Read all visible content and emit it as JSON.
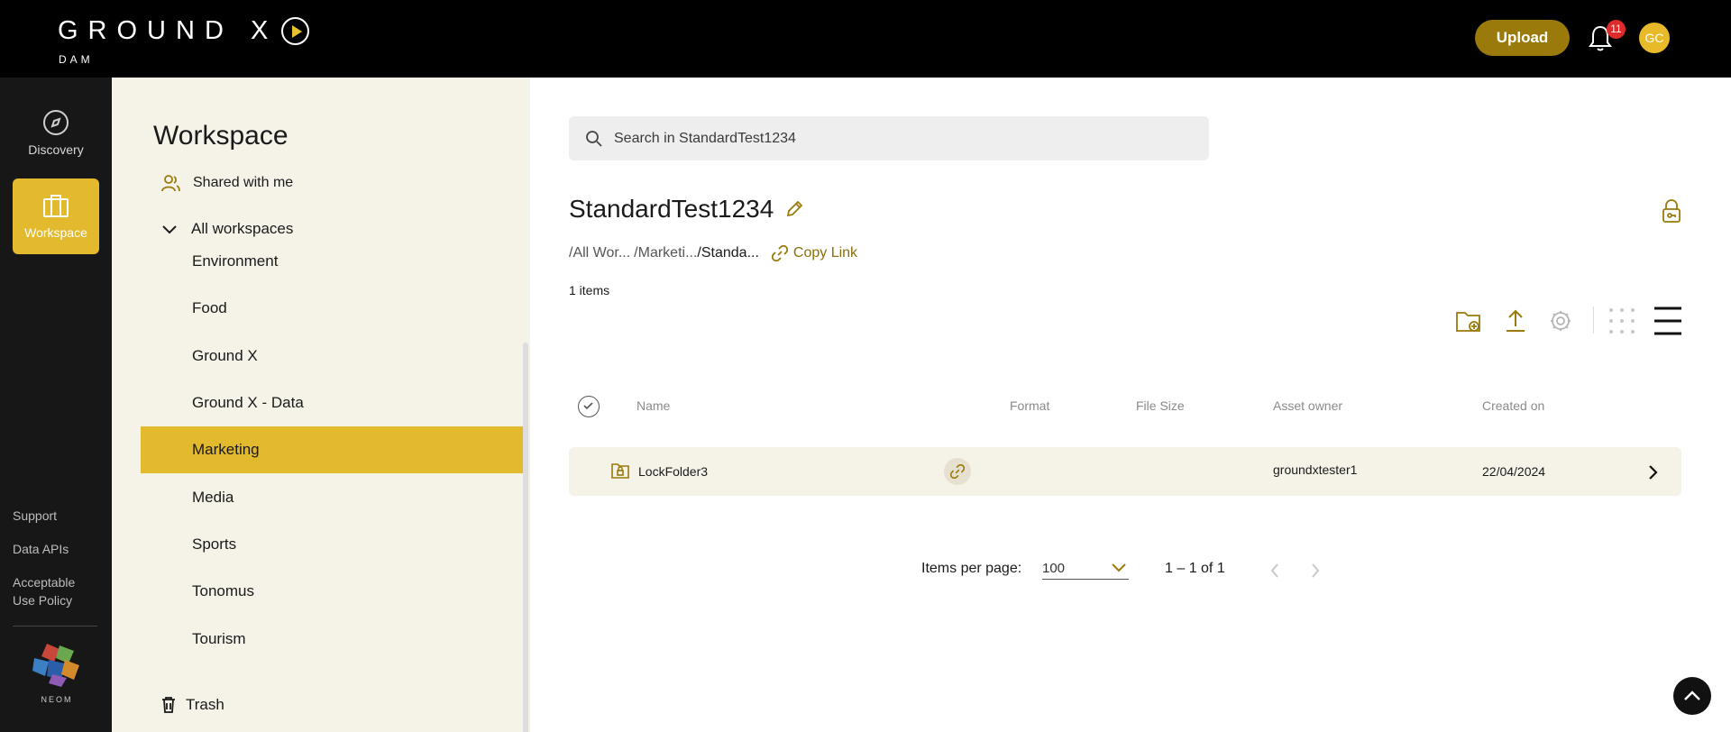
{
  "header": {
    "logo_main": "GROUND X",
    "logo_sub": "DAM",
    "upload_label": "Upload",
    "notification_count": "11",
    "avatar_initials": "GC"
  },
  "rail": {
    "discovery_label": "Discovery",
    "workspace_label": "Workspace",
    "links": [
      "Support",
      "Data APIs",
      "Acceptable Use Policy"
    ],
    "brand": "NEOM"
  },
  "sidebar": {
    "title": "Workspace",
    "shared_label": "Shared with me",
    "all_workspaces_label": "All workspaces",
    "items": [
      "Environment",
      "Food",
      "Ground X",
      "Ground X - Data",
      "Marketing",
      "Media",
      "Sports",
      "Tonomus",
      "Tourism"
    ],
    "active_item": "Marketing",
    "trash_label": "Trash"
  },
  "main": {
    "search_placeholder": "Search in StandardTest1234",
    "folder_title": "StandardTest1234",
    "breadcrumb": [
      "/All Wor...",
      "/Marketi...",
      "/Standa..."
    ],
    "copy_link_label": "Copy Link",
    "items_count": "1 items",
    "columns": [
      "Name",
      "Format",
      "File Size",
      "Asset owner",
      "Created on"
    ],
    "rows": [
      {
        "name": "LockFolder3",
        "format": "",
        "file_size": "",
        "owner": "groundxtester1",
        "created": "22/04/2024"
      }
    ],
    "pagination": {
      "items_per_page_label": "Items per page:",
      "items_per_page_value": "100",
      "range": "1 – 1 of 1"
    }
  },
  "colors": {
    "accent": "#e3b92e",
    "accent_dark": "#9a7a0a",
    "sidebar_bg": "#f5f2e8",
    "rail_bg": "#171717"
  }
}
